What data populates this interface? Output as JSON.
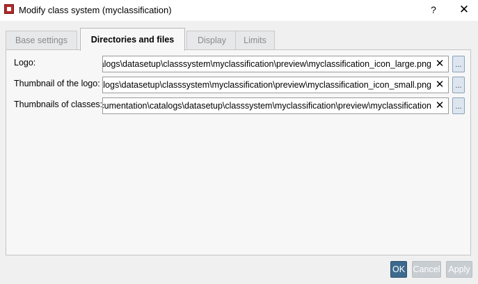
{
  "window": {
    "title": "Modify class system (myclassification)",
    "help_label": "?",
    "close_label": "✕"
  },
  "tabs": [
    {
      "label": "Base settings",
      "active": false
    },
    {
      "label": "Directories and files",
      "active": true
    },
    {
      "label": "Display",
      "active": false
    },
    {
      "label": "Limits",
      "active": false
    }
  ],
  "fields": [
    {
      "label": "Logo:",
      "value": "atalogs\\datasetup\\classsystem\\myclassification\\preview\\myclassification_icon_large.png",
      "clear_label": "✕",
      "browse_label": "..."
    },
    {
      "label": "Thumbnail of the logo:",
      "value": "atalogs\\datasetup\\classsystem\\myclassification\\preview\\myclassification_icon_small.png",
      "clear_label": "✕",
      "browse_label": "..."
    },
    {
      "label": "Thumbnails of classes:",
      "value": "ocumentation\\catalogs\\datasetup\\classsystem\\myclassification\\preview\\myclassification",
      "clear_label": "✕",
      "browse_label": "..."
    }
  ],
  "buttons": {
    "ok": "OK",
    "cancel": "Cancel",
    "apply": "Apply"
  },
  "icons": {
    "app": "app-icon",
    "help": "help-icon",
    "close": "close-icon",
    "clear": "clear-icon",
    "browse": "ellipsis-icon"
  },
  "colors": {
    "accent": "#3d6a8e",
    "disabled_button": "#c8cdd2",
    "panel_bg": "#f7f7f7",
    "window_bg": "#f0f0f0"
  }
}
